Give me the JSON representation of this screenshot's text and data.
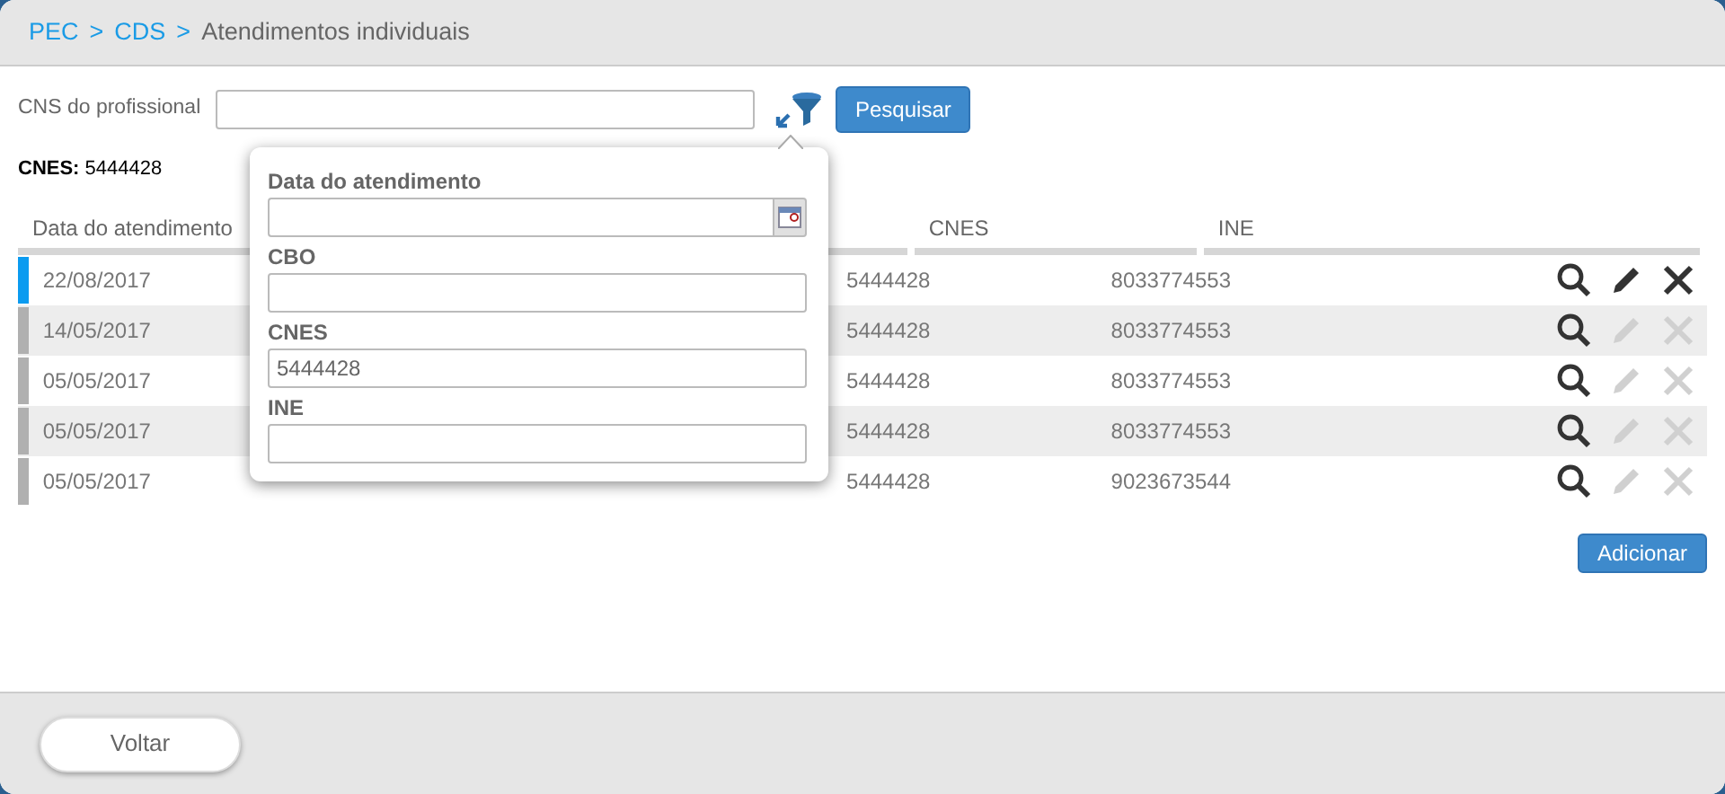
{
  "breadcrumb": [
    {
      "label": "PEC",
      "kind": "link"
    },
    {
      "label": ">",
      "kind": "separator"
    },
    {
      "label": "CDS",
      "kind": "link"
    },
    {
      "label": ">",
      "kind": "separator"
    },
    {
      "label": "Atendimentos individuais",
      "kind": "current"
    }
  ],
  "search": {
    "label": "CNS do profissional",
    "button": "Pesquisar"
  },
  "cnes_info": {
    "label": "CNES:",
    "value": "5444428"
  },
  "filter_popover": {
    "fields": [
      {
        "label": "Data do atendimento",
        "kind": "date"
      },
      {
        "label": "CBO",
        "kind": "text"
      },
      {
        "label": "CNES",
        "kind": "text",
        "value": "5444428"
      },
      {
        "label": "INE",
        "kind": "text"
      }
    ]
  },
  "table": {
    "columns": [
      "Data do atendimento",
      "CNES",
      "INE"
    ],
    "rows": [
      {
        "date": "22/08/2017",
        "cnes": "5444428",
        "ine": "8033774553",
        "color": "#0b9bf0",
        "editable": true
      },
      {
        "date": "14/05/2017",
        "cnes": "5444428",
        "ine": "8033774553",
        "color": "#b0b0b0",
        "editable": false
      },
      {
        "date": "05/05/2017",
        "cnes": "5444428",
        "ine": "8033774553",
        "color": "#b0b0b0",
        "editable": false
      },
      {
        "date": "05/05/2017",
        "cnes": "5444428",
        "ine": "8033774553",
        "color": "#b0b0b0",
        "editable": false
      },
      {
        "date": "05/05/2017",
        "cnes": "5444428",
        "ine": "9023673544",
        "color": "#b0b0b0",
        "editable": false
      }
    ]
  },
  "add_button": "Adicionar",
  "back_button": "Voltar"
}
